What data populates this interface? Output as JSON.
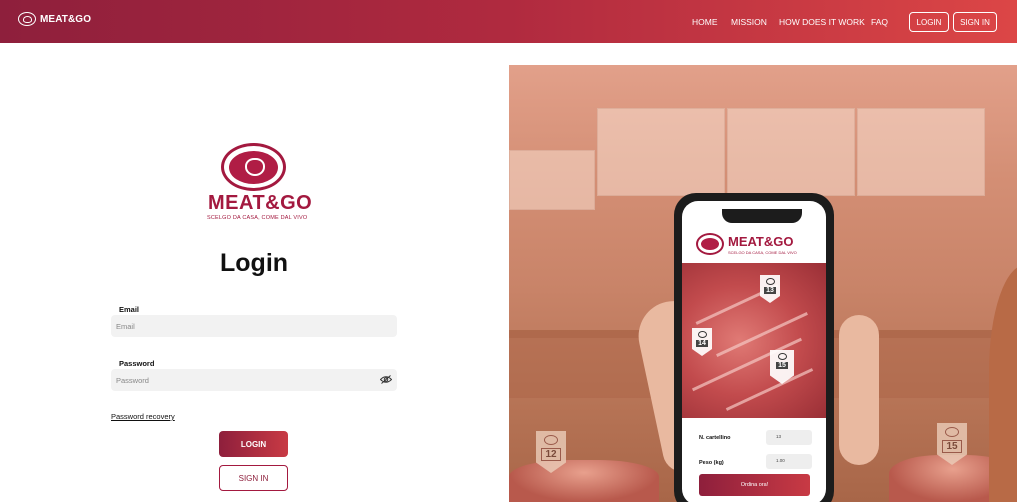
{
  "header": {
    "brand": "MEAT&GO",
    "nav": [
      "HOME",
      "MISSION",
      "HOW DOES IT WORK",
      "FAQ"
    ],
    "login_label": "LOGIN",
    "signin_label": "SIGN IN"
  },
  "logo": {
    "name": "MEAT&GO",
    "tagline": "SCELGO DA CASA, COME DAL VIVO"
  },
  "form": {
    "title": "Login",
    "email_label": "Email",
    "email_placeholder": "Email",
    "password_label": "Password",
    "password_placeholder": "Password",
    "recovery_label": "Password recovery",
    "login_button": "LOGIN",
    "signin_button": "SIGN IN"
  },
  "hero": {
    "tags": [
      "12",
      "15"
    ],
    "phone": {
      "brand": "MEAT&GO",
      "tagline": "SCELGO DA CASA, COME DAL VIVO",
      "tags": [
        "13",
        "14",
        "15"
      ],
      "ticket_label": "N. cartellino",
      "ticket_value": "13",
      "weight_label": "Peso (kg)",
      "weight_value": "1.00",
      "order_button": "Ordina ora!"
    }
  },
  "colors": {
    "brand": "#a3193f",
    "header_start": "#8e1f3c",
    "header_end": "#dc4646"
  }
}
